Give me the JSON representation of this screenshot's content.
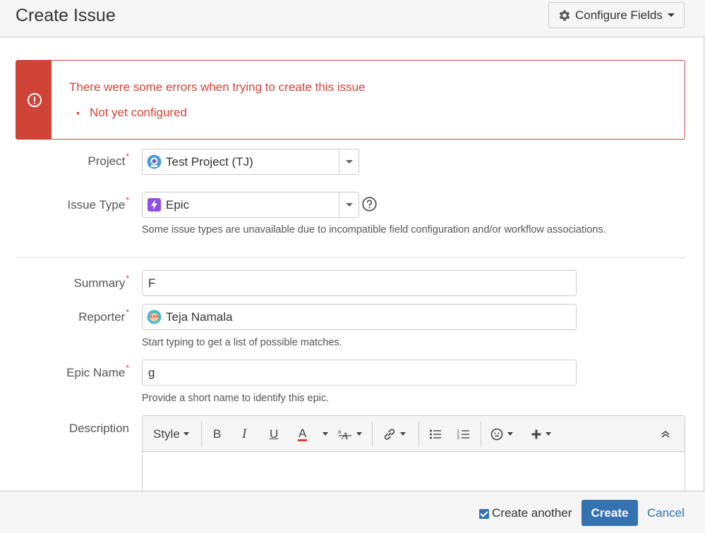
{
  "header": {
    "title": "Create Issue",
    "configure_fields_label": "Configure Fields"
  },
  "error": {
    "message": "There were some errors when trying to create this issue",
    "items": [
      "Not yet configured"
    ]
  },
  "fields": {
    "project": {
      "label": "Project",
      "required_mark": "*",
      "value": "Test Project (TJ)",
      "icon": "project-avatar-icon"
    },
    "issue_type": {
      "label": "Issue Type",
      "required_mark": "*",
      "value": "Epic",
      "icon": "epic-icon",
      "hint": "Some issue types are unavailable due to incompatible field configuration and/or workflow associations."
    },
    "summary": {
      "label": "Summary",
      "required_mark": "*",
      "value": "F"
    },
    "reporter": {
      "label": "Reporter",
      "required_mark": "*",
      "value": "Teja Namala",
      "icon": "user-avatar-icon",
      "hint": "Start typing to get a list of possible matches."
    },
    "epic_name": {
      "label": "Epic Name",
      "required_mark": "*",
      "value": "g",
      "hint": "Provide a short name to identify this epic."
    },
    "description": {
      "label": "Description"
    }
  },
  "editor_toolbar": {
    "style_label": "Style",
    "bold_label": "B",
    "italic_label": "I",
    "underline_label": "U",
    "text_color_label": "A"
  },
  "footer": {
    "create_another_label": "Create another",
    "create_another_checked": true,
    "create_label": "Create",
    "cancel_label": "Cancel"
  },
  "colors": {
    "accent": "#3572b0",
    "error": "#d04437",
    "epic": "#904ee2"
  }
}
